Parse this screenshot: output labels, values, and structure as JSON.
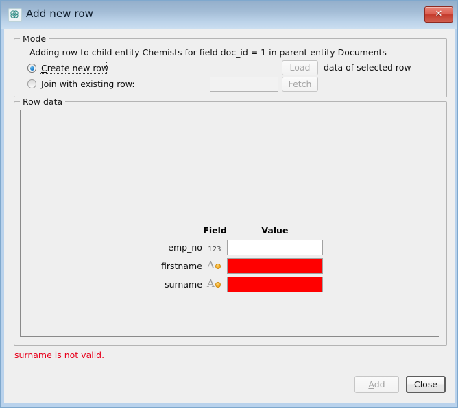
{
  "window": {
    "title": "Add new row",
    "app_icon": "atom-icon",
    "close_label": "✕"
  },
  "mode": {
    "group_title": "Mode",
    "description": "Adding row to child entity Chemists for field doc_id = 1 in parent entity Documents",
    "options": [
      {
        "label_pre": "",
        "mnemonic": "C",
        "label_post": "reate new row",
        "selected": true,
        "focused": true
      },
      {
        "label_pre": "Join with ",
        "mnemonic": "e",
        "label_post": "xisting row:",
        "selected": false,
        "focused": false
      }
    ],
    "load_button": "Load",
    "load_suffix": "data of selected row",
    "fetch_button_pre": "",
    "fetch_button_mnemonic": "F",
    "fetch_button_post": "etch",
    "join_input_value": "",
    "join_input_placeholder": ""
  },
  "row_data": {
    "group_title": "Row data",
    "columns": [
      "Field",
      "Value"
    ],
    "rows": [
      {
        "field": "emp_no",
        "type_icon": "number-type-icon",
        "type_glyph": "123",
        "value": "",
        "invalid": false
      },
      {
        "field": "firstname",
        "type_icon": "text-type-icon",
        "type_glyph": "A",
        "value": "",
        "invalid": true
      },
      {
        "field": "surname",
        "type_icon": "text-type-icon",
        "type_glyph": "A",
        "value": "",
        "invalid": true
      }
    ]
  },
  "footer": {
    "error": "surname is not valid.",
    "add_mnemonic": "A",
    "add_label_post": "dd",
    "close_label": "Close"
  },
  "colors": {
    "titlebar_top": "#93afcb",
    "titlebar_bottom": "#cadef0",
    "window_chrome": "#b9d2ec",
    "client_bg": "#efefef",
    "invalid_cell": "#ff0000",
    "error_text": "#e8001c",
    "close_button": "#c43b2c",
    "radio_dot": "#1273c4",
    "type_icon_accent": "#f0a31b"
  }
}
